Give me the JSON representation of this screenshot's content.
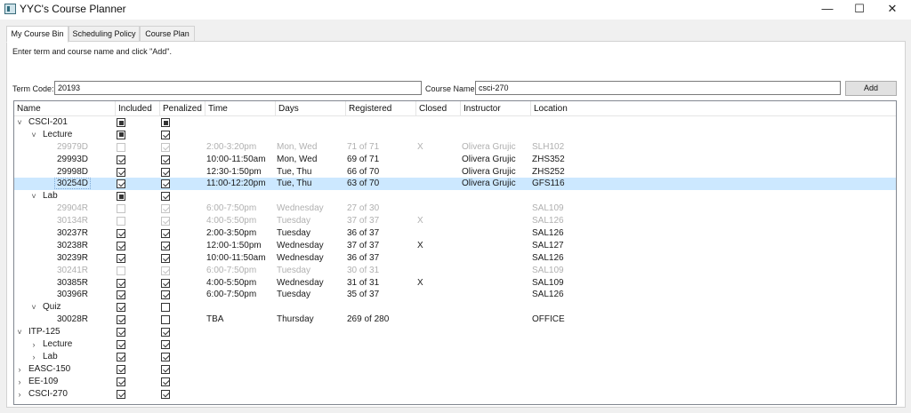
{
  "window": {
    "title": "YYC's Course Planner",
    "minimize": "—",
    "maximize": "☐",
    "close": "✕"
  },
  "tabs": [
    "My Course Bin",
    "Scheduling Policy",
    "Course Plan"
  ],
  "instruction": "Enter term and course name and click \"Add\".",
  "term_label": "Term Code:",
  "term_value": "20193",
  "course_label": "Course Name:",
  "course_value": "csci-270",
  "add_label": "Add",
  "columns": [
    "Name",
    "Included",
    "Penalized",
    "Time",
    "Days",
    "Registered",
    "Closed",
    "Instructor",
    "Location"
  ],
  "rows": [
    {
      "level": 0,
      "exp": "v",
      "name": "CSCI-201",
      "inc": "partial",
      "pen": "partial"
    },
    {
      "level": 1,
      "exp": "v",
      "name": "Lecture",
      "inc": "partial",
      "pen": "checked"
    },
    {
      "level": 2,
      "name": "29979D",
      "inc": "",
      "pen": "checked",
      "time": "2:00-3:20pm",
      "days": "Mon, Wed",
      "reg": "71 of 71",
      "closed": "X",
      "instr": "Olivera Grujic",
      "loc": "SLH102",
      "dim": true
    },
    {
      "level": 2,
      "name": "29993D",
      "inc": "checked",
      "pen": "checked",
      "time": "10:00-11:50am",
      "days": "Mon, Wed",
      "reg": "69 of 71",
      "closed": "",
      "instr": "Olivera Grujic",
      "loc": "ZHS352"
    },
    {
      "level": 2,
      "name": "29998D",
      "inc": "checked",
      "pen": "checked",
      "time": "12:30-1:50pm",
      "days": "Tue, Thu",
      "reg": "66 of 70",
      "closed": "",
      "instr": "Olivera Grujic",
      "loc": "ZHS252"
    },
    {
      "level": 2,
      "name": "30254D",
      "inc": "checked",
      "pen": "checked",
      "time": "11:00-12:20pm",
      "days": "Tue, Thu",
      "reg": "63 of 70",
      "closed": "",
      "instr": "Olivera Grujic",
      "loc": "GFS116",
      "selected": true
    },
    {
      "level": 1,
      "exp": "v",
      "name": "Lab",
      "inc": "partial",
      "pen": "checked"
    },
    {
      "level": 2,
      "name": "29904R",
      "inc": "",
      "pen": "checked",
      "time": "6:00-7:50pm",
      "days": "Wednesday",
      "reg": "27 of 30",
      "closed": "",
      "instr": "",
      "loc": "SAL109",
      "dim": true
    },
    {
      "level": 2,
      "name": "30134R",
      "inc": "",
      "pen": "checked",
      "time": "4:00-5:50pm",
      "days": "Tuesday",
      "reg": "37 of 37",
      "closed": "X",
      "instr": "",
      "loc": "SAL126",
      "dim": true
    },
    {
      "level": 2,
      "name": "30237R",
      "inc": "checked",
      "pen": "checked",
      "time": "2:00-3:50pm",
      "days": "Tuesday",
      "reg": "36 of 37",
      "closed": "",
      "instr": "",
      "loc": "SAL126"
    },
    {
      "level": 2,
      "name": "30238R",
      "inc": "checked",
      "pen": "checked",
      "time": "12:00-1:50pm",
      "days": "Wednesday",
      "reg": "37 of 37",
      "closed": "X",
      "instr": "",
      "loc": "SAL127"
    },
    {
      "level": 2,
      "name": "30239R",
      "inc": "checked",
      "pen": "checked",
      "time": "10:00-11:50am",
      "days": "Wednesday",
      "reg": "36 of 37",
      "closed": "",
      "instr": "",
      "loc": "SAL126"
    },
    {
      "level": 2,
      "name": "30241R",
      "inc": "",
      "pen": "checked",
      "time": "6:00-7:50pm",
      "days": "Tuesday",
      "reg": "30 of 31",
      "closed": "",
      "instr": "",
      "loc": "SAL109",
      "dim": true
    },
    {
      "level": 2,
      "name": "30385R",
      "inc": "checked",
      "pen": "checked",
      "time": "4:00-5:50pm",
      "days": "Wednesday",
      "reg": "31 of 31",
      "closed": "X",
      "instr": "",
      "loc": "SAL109"
    },
    {
      "level": 2,
      "name": "30396R",
      "inc": "checked",
      "pen": "checked",
      "time": "6:00-7:50pm",
      "days": "Tuesday",
      "reg": "35 of 37",
      "closed": "",
      "instr": "",
      "loc": "SAL126"
    },
    {
      "level": 1,
      "exp": "v",
      "name": "Quiz",
      "inc": "checked",
      "pen": ""
    },
    {
      "level": 2,
      "name": "30028R",
      "inc": "checked",
      "pen": "",
      "time": "TBA",
      "days": "Thursday",
      "reg": "269 of 280",
      "closed": "",
      "instr": "",
      "loc": "OFFICE"
    },
    {
      "level": 0,
      "exp": "v",
      "name": "ITP-125",
      "inc": "checked",
      "pen": "checked"
    },
    {
      "level": 1,
      "exp": ">",
      "name": "Lecture",
      "inc": "checked",
      "pen": "checked"
    },
    {
      "level": 1,
      "exp": ">",
      "name": "Lab",
      "inc": "checked",
      "pen": "checked"
    },
    {
      "level": 0,
      "exp": ">",
      "name": "EASC-150",
      "inc": "checked",
      "pen": "checked"
    },
    {
      "level": 0,
      "exp": ">",
      "name": "EE-109",
      "inc": "checked",
      "pen": "checked"
    },
    {
      "level": 0,
      "exp": ">",
      "name": "CSCI-270",
      "inc": "checked",
      "pen": "checked"
    }
  ]
}
